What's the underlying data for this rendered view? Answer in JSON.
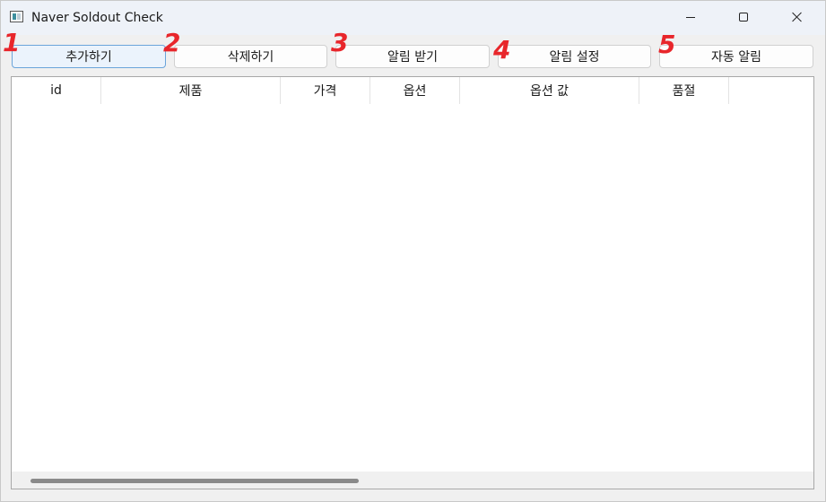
{
  "window": {
    "title": "Naver Soldout Check",
    "icon": "app-window-icon",
    "controls": [
      "minimize-icon",
      "maximize-icon",
      "close-icon"
    ]
  },
  "toolbar": {
    "buttons": [
      {
        "label": "추가하기",
        "active": true
      },
      {
        "label": "삭제하기",
        "active": false
      },
      {
        "label": "알림 받기",
        "active": false
      },
      {
        "label": "알림 설정",
        "active": false
      },
      {
        "label": "자동 알림",
        "active": false
      }
    ]
  },
  "annotations": [
    "1",
    "2",
    "3",
    "4",
    "5"
  ],
  "annotation_color": "#e8262b",
  "table": {
    "columns": [
      "id",
      "제품",
      "가격",
      "옵션",
      "옵션 값",
      "품절"
    ],
    "rows": []
  },
  "colors": {
    "active_button_border": "#6aa4da",
    "active_button_bg": "#ebf3fc"
  }
}
